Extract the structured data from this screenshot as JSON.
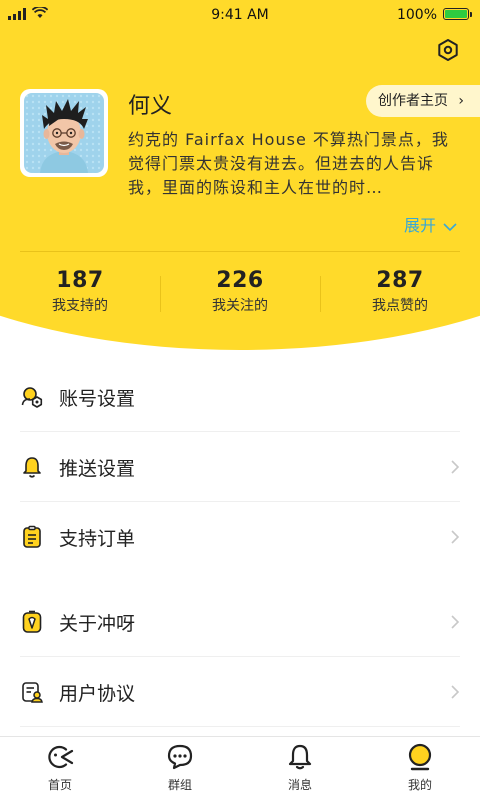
{
  "status_bar": {
    "time": "9:41 AM",
    "battery": "100%"
  },
  "profile": {
    "name": "何义",
    "bio": "约克的 Fairfax House 不算热门景点，我觉得门票太贵没有进去。但进去的人告诉我，里面的陈设和主人在世的时…",
    "expand_label": "展开",
    "creator_button": "创作者主页"
  },
  "stats": [
    {
      "value": "187",
      "label": "我支持的"
    },
    {
      "value": "226",
      "label": "我关注的"
    },
    {
      "value": "287",
      "label": "我点赞的"
    }
  ],
  "menu": [
    {
      "label": "账号设置",
      "icon": "account-settings-icon"
    },
    {
      "label": "推送设置",
      "icon": "bell-icon"
    },
    {
      "label": "支持订单",
      "icon": "order-list-icon"
    },
    {
      "label": "关于冲呀",
      "icon": "about-icon"
    },
    {
      "label": "用户协议",
      "icon": "agreement-icon"
    }
  ],
  "tabbar": [
    {
      "label": "首页",
      "icon": "home-icon"
    },
    {
      "label": "群组",
      "icon": "chat-bubble-icon"
    },
    {
      "label": "消息",
      "icon": "bell-icon"
    },
    {
      "label": "我的",
      "icon": "profile-icon",
      "active": true
    }
  ],
  "colors": {
    "accent": "#FFDA2A",
    "link": "#37A8D8",
    "icon_fill": "#FFD21F"
  }
}
